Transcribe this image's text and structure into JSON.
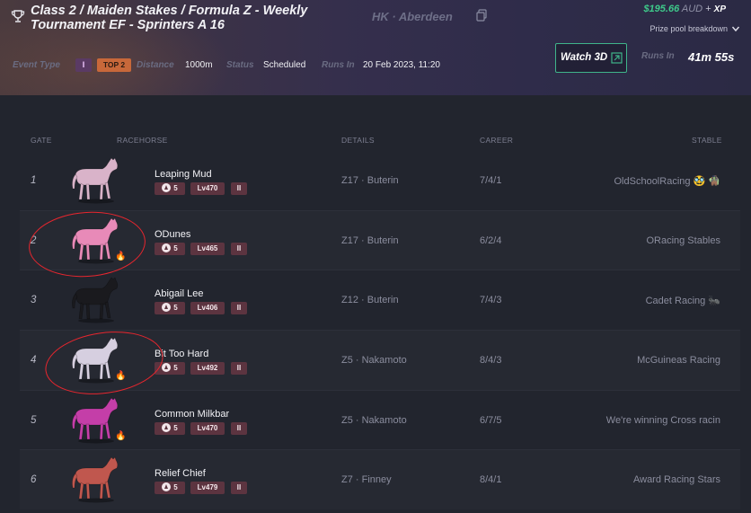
{
  "header": {
    "title": "Class 2 / Maiden Stakes / Formula Z - Weekly Tournament EF - Sprinters A 16",
    "track": "HK · Aberdeen",
    "prize_amount": "$195.66",
    "prize_currency": "AUD",
    "prize_plus": "+",
    "prize_xp": "XP",
    "prize_breakdown_label": "Prize pool breakdown",
    "event_type_label": "Event Type",
    "event_type_badge": "I",
    "top_badge": "TOP 2",
    "distance_label": "Distance",
    "distance_value": "1000m",
    "status_label": "Status",
    "status_value": "Scheduled",
    "runs_in_label": "Runs In",
    "runs_in_value": "20 Feb 2023, 11:20",
    "watch_label": "Watch 3D",
    "runs_in_label2": "Runs In",
    "countdown": "41m 55s"
  },
  "columns": {
    "gate": "GATE",
    "racehorse": "RACEHORSE",
    "details": "DETAILS",
    "career": "CAREER",
    "stable": "STABLE"
  },
  "rows": [
    {
      "gate": "1",
      "name": "Leaping Mud",
      "rating": "5",
      "level": "Lv470",
      "class": "II",
      "details": "Z17 · Buterin",
      "career": "7/4/1",
      "stable": "OldSchoolRacing 🥸 🧌",
      "color": "#d9b3c9",
      "fire": false,
      "circled": false
    },
    {
      "gate": "2",
      "name": "ODunes",
      "rating": "5",
      "level": "Lv465",
      "class": "II",
      "details": "Z17 · Buterin",
      "career": "6/2/4",
      "stable": "ORacing Stables",
      "color": "#e88ab8",
      "fire": true,
      "circled": true
    },
    {
      "gate": "3",
      "name": "Abigail Lee",
      "rating": "5",
      "level": "Lv406",
      "class": "II",
      "details": "Z12 · Buterin",
      "career": "7/4/3",
      "stable": "Cadet Racing 🐜",
      "color": "#1a1a1e",
      "fire": false,
      "circled": false
    },
    {
      "gate": "4",
      "name": "Bit Too Hard",
      "rating": "5",
      "level": "Lv492",
      "class": "II",
      "details": "Z5 · Nakamoto",
      "career": "8/4/3",
      "stable": "McGuineas Racing",
      "color": "#d6cfe0",
      "fire": true,
      "circled": true
    },
    {
      "gate": "5",
      "name": "Common Milkbar",
      "rating": "5",
      "level": "Lv470",
      "class": "II",
      "details": "Z5 · Nakamoto",
      "career": "6/7/5",
      "stable": "We're winning Cross racin",
      "color": "#c43ea8",
      "fire": true,
      "circled": false
    },
    {
      "gate": "6",
      "name": "Relief Chief",
      "rating": "5",
      "level": "Lv479",
      "class": "II",
      "details": "Z7 · Finney",
      "career": "8/4/1",
      "stable": "Award Racing Stars",
      "color": "#c0574e",
      "fire": false,
      "circled": false
    }
  ]
}
